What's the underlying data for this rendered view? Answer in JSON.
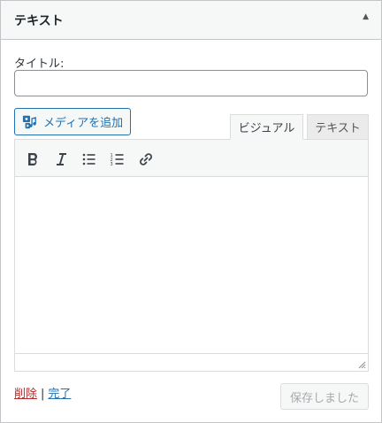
{
  "widget": {
    "title": "テキスト",
    "toggle_icon": "arrow-up-icon"
  },
  "form": {
    "title_label": "タイトル:",
    "title_value": "",
    "title_placeholder": ""
  },
  "editor": {
    "media_button_label": "メディアを追加",
    "media_icon": "media-icon",
    "tabs": [
      {
        "label": "ビジュアル",
        "active": true
      },
      {
        "label": "テキスト",
        "active": false
      }
    ],
    "toolbar": [
      {
        "name": "bold",
        "icon": "bold-icon"
      },
      {
        "name": "italic",
        "icon": "italic-icon"
      },
      {
        "name": "bulleted-list",
        "icon": "bulleted-list-icon"
      },
      {
        "name": "numbered-list",
        "icon": "numbered-list-icon"
      },
      {
        "name": "link",
        "icon": "link-icon"
      }
    ],
    "content": ""
  },
  "actions": {
    "delete_label": "削除",
    "separator": "|",
    "done_label": "完了",
    "save_label": "保存しました",
    "save_disabled": true
  },
  "colors": {
    "accent": "#2271b1",
    "delete": "#b32d2e",
    "disabled_text": "#a7aaad",
    "border": "#c3c4c7"
  }
}
